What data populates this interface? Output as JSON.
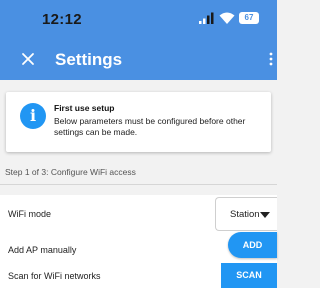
{
  "status_bar": {
    "time": "12:12",
    "battery_level": "67"
  },
  "header": {
    "title": "Settings"
  },
  "notice": {
    "title": "First use setup",
    "body": "Below parameters must be configured before other settings can be made."
  },
  "step": {
    "label": "Step 1 of 3: Configure WiFi access"
  },
  "wifi_mode": {
    "label": "WiFi mode",
    "value": "Station"
  },
  "add_ap": {
    "label": "Add AP manually",
    "button": "ADD"
  },
  "scan": {
    "label": "Scan for WiFi networks",
    "button": "SCAN"
  },
  "colors": {
    "app_bar": "#4a90e2",
    "accent": "#2196f3"
  },
  "icons": [
    "signal-icon",
    "wifi-icon",
    "battery-icon",
    "close-icon",
    "more-vert-icon",
    "info-icon",
    "chevron-down-icon"
  ]
}
